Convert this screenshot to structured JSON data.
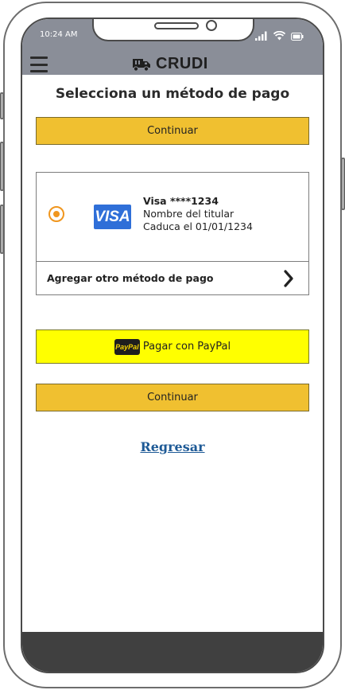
{
  "status_bar": {
    "time": "10:24 AM"
  },
  "navbar": {
    "brand": "CRUDI",
    "menu_icon": "hamburger-icon",
    "brand_icon": "truck-icon"
  },
  "page": {
    "title": "Selecciona un método de pago"
  },
  "buttons": {
    "continue_top": "Continuar",
    "continue_bottom": "Continuar",
    "paypal": "Pagar con PayPal",
    "paypal_logo_text": "PayPal"
  },
  "payment_method": {
    "selected": true,
    "brand_logo": "VISA",
    "line1": "Visa ****1234",
    "line2": "Nombre del titular",
    "line3": "Caduca el 01/01/1234"
  },
  "add_method": {
    "label": "Agregar otro método de pago"
  },
  "back_link": {
    "label": "Regresar"
  },
  "colors": {
    "header": "#8a8e98",
    "button_yellow": "#f0c030",
    "paypal_yellow": "#ffff00",
    "radio_orange": "#f0961e",
    "visa_blue": "#2f6fd8",
    "link_blue": "#1e5a96"
  }
}
